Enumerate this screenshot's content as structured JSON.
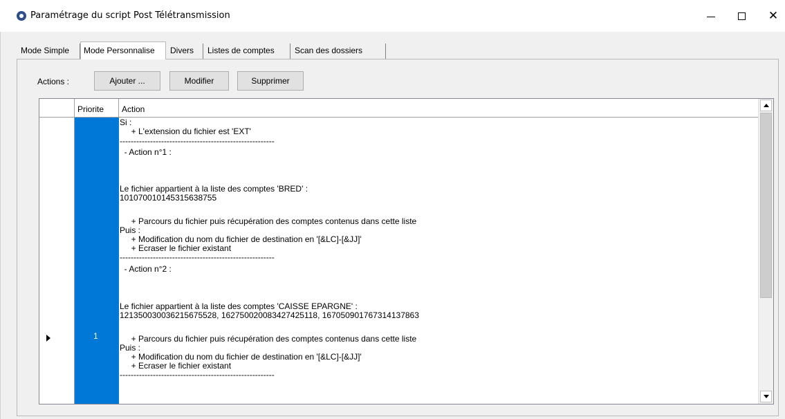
{
  "window": {
    "title": "Paramétrage du script Post Télétransmission",
    "icon": "app-icon",
    "controls": {
      "minimize": "–",
      "maximize": "□",
      "close": "✕"
    }
  },
  "tabs": [
    {
      "label": "Mode Simple",
      "active": false
    },
    {
      "label": "Mode Personnalise",
      "active": true
    },
    {
      "label": "Divers",
      "active": false
    },
    {
      "label": "Listes de comptes",
      "active": false
    },
    {
      "label": "Scan des dossiers",
      "active": false
    }
  ],
  "actions": {
    "label": "Actions :",
    "add_label": "Ajouter ...",
    "edit_label": "Modifier",
    "delete_label": "Supprimer"
  },
  "grid": {
    "columns": {
      "priority": "Priorite",
      "action": "Action"
    },
    "rows": [
      {
        "selected": true,
        "priority": "1",
        "lines": [
          "Si :",
          "     + L'extension du fichier est 'EXT'",
          "--------------------------------------------------------",
          "  - Action n°1 :",
          "",
          "",
          "Le fichier appartient à la liste des comptes 'BRED' :",
          "10107001014531563875­5",
          "",
          "     + Parcours du fichier puis récupération des comptes contenus dans cette liste",
          "Puis :",
          "     + Modification du nom du fichier de destination en '[&LC]-[&JJ]'",
          "     + Ecraser le fichier existant",
          "--------------------------------------------------------",
          "  - Action n°2 :",
          "",
          "",
          "Le fichier appartient à la liste des comptes 'CAISSE EPARGNE' :",
          "12135003003621567552­8, 16275002008342742511­8, 16705090176731413786­3",
          "",
          "     + Parcours du fichier puis récupération des comptes contenus dans cette liste",
          "Puis :",
          "     + Modification du nom du fichier de destination en '[&LC]-[&JJ]'",
          "     + Ecraser le fichier existant",
          "--------------------------------------------------------"
        ]
      }
    ]
  },
  "colors": {
    "selection": "#0078d7",
    "client": "#f0f0f0"
  }
}
